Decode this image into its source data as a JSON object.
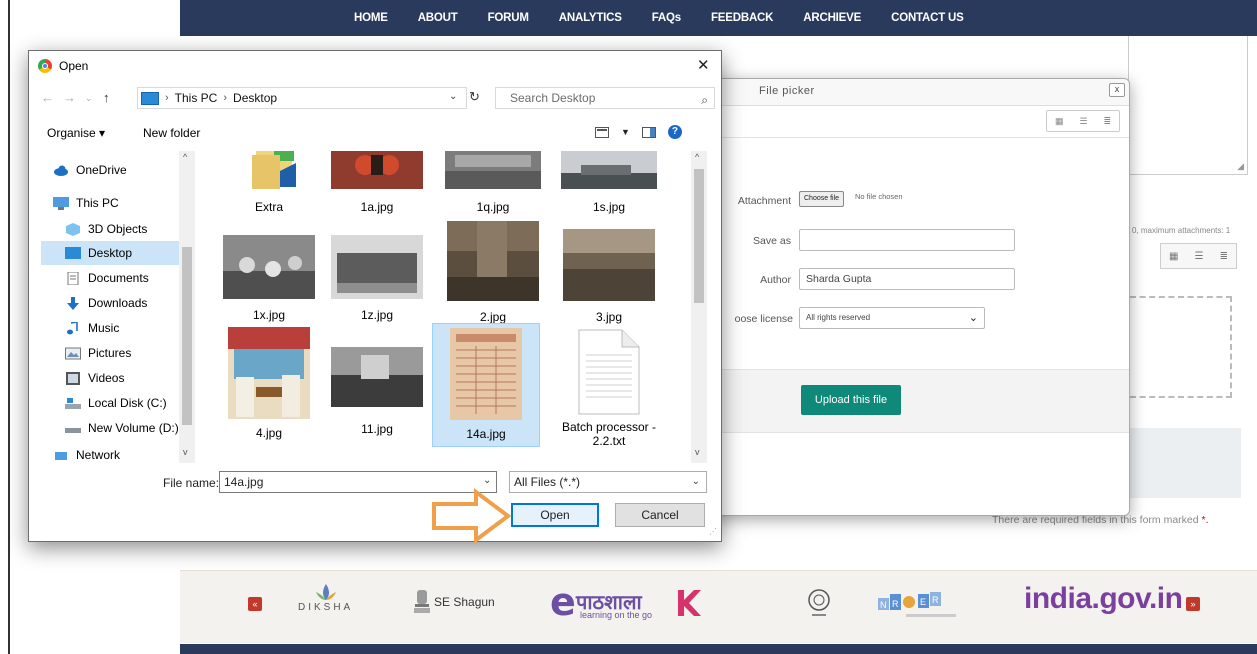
{
  "nav": {
    "links": [
      "HOME",
      "ABOUT",
      "FORUM",
      "ANALYTICS",
      "FAQs",
      "FEEDBACK",
      "ARCHIEVE",
      "CONTACT US"
    ]
  },
  "background": {
    "attachments_note": "0, maximum attachments: 1",
    "required_note": "There are required fields in this form marked",
    "required_star": "*.",
    "footer": {
      "diksha": "DIKSHA",
      "shagun": "SE Shagun",
      "pathshala_tagline": "learning on the go",
      "pathshala_word": "पाठशाला",
      "nroer": "NROER",
      "india_gov": "india.gov.in"
    }
  },
  "file_picker": {
    "title": "File picker",
    "close": "x",
    "attachment_label": "Attachment",
    "choose_file": "Choose file",
    "no_file": "No file chosen",
    "save_as_label": "Save as",
    "save_as_value": "",
    "author_label": "Author",
    "author_value": "Sharda Gupta",
    "license_label": "oose license",
    "license_value": "All rights reserved",
    "upload_button": "Upload this file"
  },
  "open_dialog": {
    "title": "Open",
    "path": [
      "This PC",
      "Desktop"
    ],
    "search_placeholder": "Search Desktop",
    "organise": "Organise ▾",
    "new_folder": "New folder",
    "nav_items": [
      {
        "label": "OneDrive",
        "icon": "cloud-icon"
      },
      {
        "label": "This PC",
        "icon": "computer-icon"
      },
      {
        "label": "3D Objects",
        "icon": "cube-icon"
      },
      {
        "label": "Desktop",
        "icon": "desktop-icon",
        "selected": true
      },
      {
        "label": "Documents",
        "icon": "document-icon"
      },
      {
        "label": "Downloads",
        "icon": "download-icon"
      },
      {
        "label": "Music",
        "icon": "music-icon"
      },
      {
        "label": "Pictures",
        "icon": "pictures-icon"
      },
      {
        "label": "Videos",
        "icon": "video-icon"
      },
      {
        "label": "Local Disk (C:)",
        "icon": "disk-icon"
      },
      {
        "label": "New Volume (D:)",
        "icon": "drive-icon"
      },
      {
        "label": "Network",
        "icon": "network-icon"
      }
    ],
    "files": [
      {
        "name": "Extra"
      },
      {
        "name": "1a.jpg"
      },
      {
        "name": "1q.jpg"
      },
      {
        "name": "1s.jpg"
      },
      {
        "name": "1x.jpg"
      },
      {
        "name": "1z.jpg"
      },
      {
        "name": "2.jpg"
      },
      {
        "name": "3.jpg"
      },
      {
        "name": "4.jpg"
      },
      {
        "name": "11.jpg"
      },
      {
        "name": "14a.jpg",
        "selected": true
      },
      {
        "name": "Batch processor - 2.2.txt"
      }
    ],
    "file_name_label": "File name:",
    "file_name_value": "14a.jpg",
    "filter_value": "All Files (*.*)",
    "open_button": "Open",
    "cancel_button": "Cancel"
  },
  "colors": {
    "nav_bg": "#2a3a5c",
    "upload_btn": "#0f8a7a",
    "selection": "#cce4f7",
    "arrow": "#f0a04b"
  }
}
